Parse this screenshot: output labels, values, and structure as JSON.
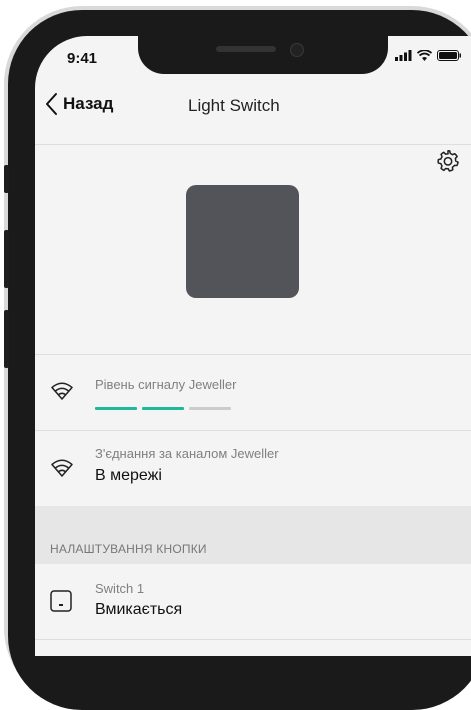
{
  "status_bar": {
    "time": "9:41"
  },
  "nav": {
    "back_label": "Назад",
    "title": "Light Switch"
  },
  "signal": {
    "label": "Рівень сигналу Jeweller",
    "bars_total": 3,
    "bars_active": 2,
    "active_color": "#1fb89a",
    "inactive_color": "#cccccc"
  },
  "connection": {
    "label": "З'єднання за каналом Jeweller",
    "value": "В мережі"
  },
  "section": {
    "title": "НАЛАШТУВАННЯ КНОПКИ"
  },
  "switch1": {
    "label": "Switch 1",
    "value": "Вмикається"
  },
  "icons": {
    "gear": "gear-icon",
    "back": "chevron-left-icon",
    "wifi": "wireless-icon",
    "switch": "switch-icon"
  }
}
